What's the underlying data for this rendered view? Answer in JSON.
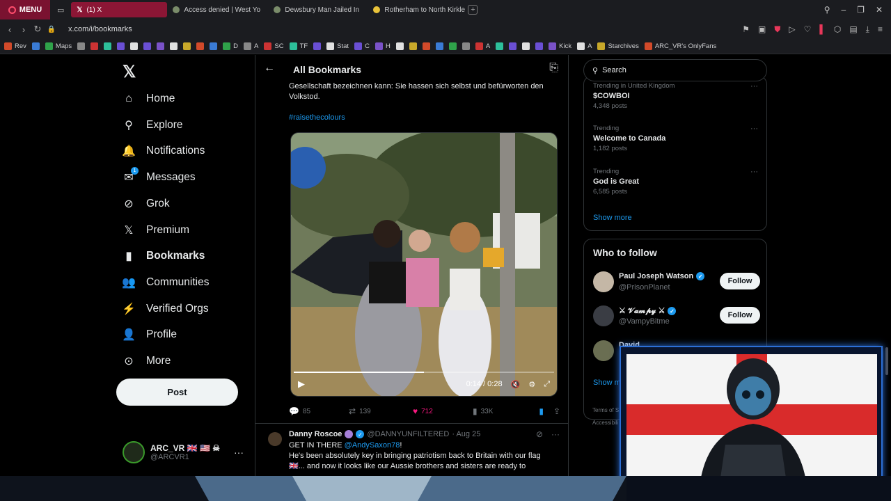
{
  "browser": {
    "menu_label": "MENU",
    "tabs": [
      {
        "label": "(1) X",
        "active": true
      },
      {
        "label": "Access denied | West Yo"
      },
      {
        "label": "Dewsbury Man Jailed In"
      },
      {
        "label": "Rotherham to North Kirkle"
      }
    ],
    "url": "x.com/i/bookmarks",
    "bookmarks": [
      "Rev",
      "",
      "Maps",
      "",
      "",
      "",
      "",
      "",
      "",
      "",
      "",
      "",
      "",
      "",
      "D",
      "A",
      "SC",
      "TF",
      "",
      "Stat",
      "C",
      "H",
      "",
      "",
      "",
      "",
      "",
      "",
      "A",
      "",
      "",
      "",
      "",
      "Kick",
      "A",
      "Starchives",
      "ARC_VR's OnlyFans"
    ]
  },
  "sidebar": {
    "items": [
      {
        "label": "Home",
        "icon": "home-icon",
        "glyph": "⌂"
      },
      {
        "label": "Explore",
        "icon": "search-icon",
        "glyph": "⚲"
      },
      {
        "label": "Notifications",
        "icon": "bell-icon",
        "glyph": "🔔"
      },
      {
        "label": "Messages",
        "icon": "envelope-icon",
        "glyph": "✉",
        "badge": "1"
      },
      {
        "label": "Grok",
        "icon": "grok-icon",
        "glyph": "⊘"
      },
      {
        "label": "Premium",
        "icon": "x-icon",
        "glyph": "𝕏"
      },
      {
        "label": "Bookmarks",
        "icon": "bookmark-icon",
        "glyph": "▮",
        "active": true
      },
      {
        "label": "Communities",
        "icon": "people-icon",
        "glyph": "👥"
      },
      {
        "label": "Verified Orgs",
        "icon": "lightning-icon",
        "glyph": "⚡"
      },
      {
        "label": "Profile",
        "icon": "person-icon",
        "glyph": "👤"
      },
      {
        "label": "More",
        "icon": "more-icon",
        "glyph": "⊙"
      }
    ],
    "post_label": "Post",
    "account": {
      "name": "ARC_VR 🇬🇧 🇺🇸 ☠",
      "handle": "@ARCVR1"
    }
  },
  "main": {
    "title": "All Bookmarks",
    "tweet1": {
      "text": "Gesellschaft bezeichnen kann: Sie hassen sich selbst und befürworten den Volkstod.",
      "hashtag": "#raisethecolours",
      "video": {
        "time": "0:14 / 0:28",
        "progress": 0.5
      },
      "replies": "85",
      "reposts": "139",
      "likes": "712",
      "views": "33K"
    },
    "tweet2": {
      "name": "Danny Roscoe",
      "handle": "@DANNYUNFILTERED",
      "date": "· Aug 25",
      "line1_prefix": "GET IN THERE ",
      "line1_mention": "@AndySaxon78",
      "line1_suffix": "!",
      "line2": "He's been absolutely key in bringing patriotism back to Britain with our flag",
      "line3": "🇬🇧... and now it looks like our Aussie brothers and sisters are ready to"
    }
  },
  "right": {
    "search_placeholder": "Search",
    "trends": [
      {
        "context": "Trending in United Kingdom",
        "name": "$COWBOI",
        "posts": "4,348 posts"
      },
      {
        "context": "Trending",
        "name": "Welcome to Canada",
        "posts": "1,182 posts"
      },
      {
        "context": "Trending",
        "name": "God is Great",
        "posts": "6,585 posts"
      }
    ],
    "show_more": "Show more",
    "who_to_follow_title": "Who to follow",
    "follow_suggestions": [
      {
        "name": "Paul Joseph Watson",
        "handle": "@PrisonPlanet",
        "follow": "Follow"
      },
      {
        "name": "⚔ 𝓥𝓪𝓶𝓹𝔂 ⚔",
        "handle": "@VampyBitme",
        "follow": "Follow"
      },
      {
        "name": "David",
        "handle": "",
        "follow": ""
      }
    ],
    "wtf_show_more": "Show m",
    "footer_1": "Terms of S",
    "footer_2": "Accessibili"
  },
  "colors": {
    "accent": "#1d9bf0",
    "like": "#f91880",
    "opera": "#8b1635"
  }
}
